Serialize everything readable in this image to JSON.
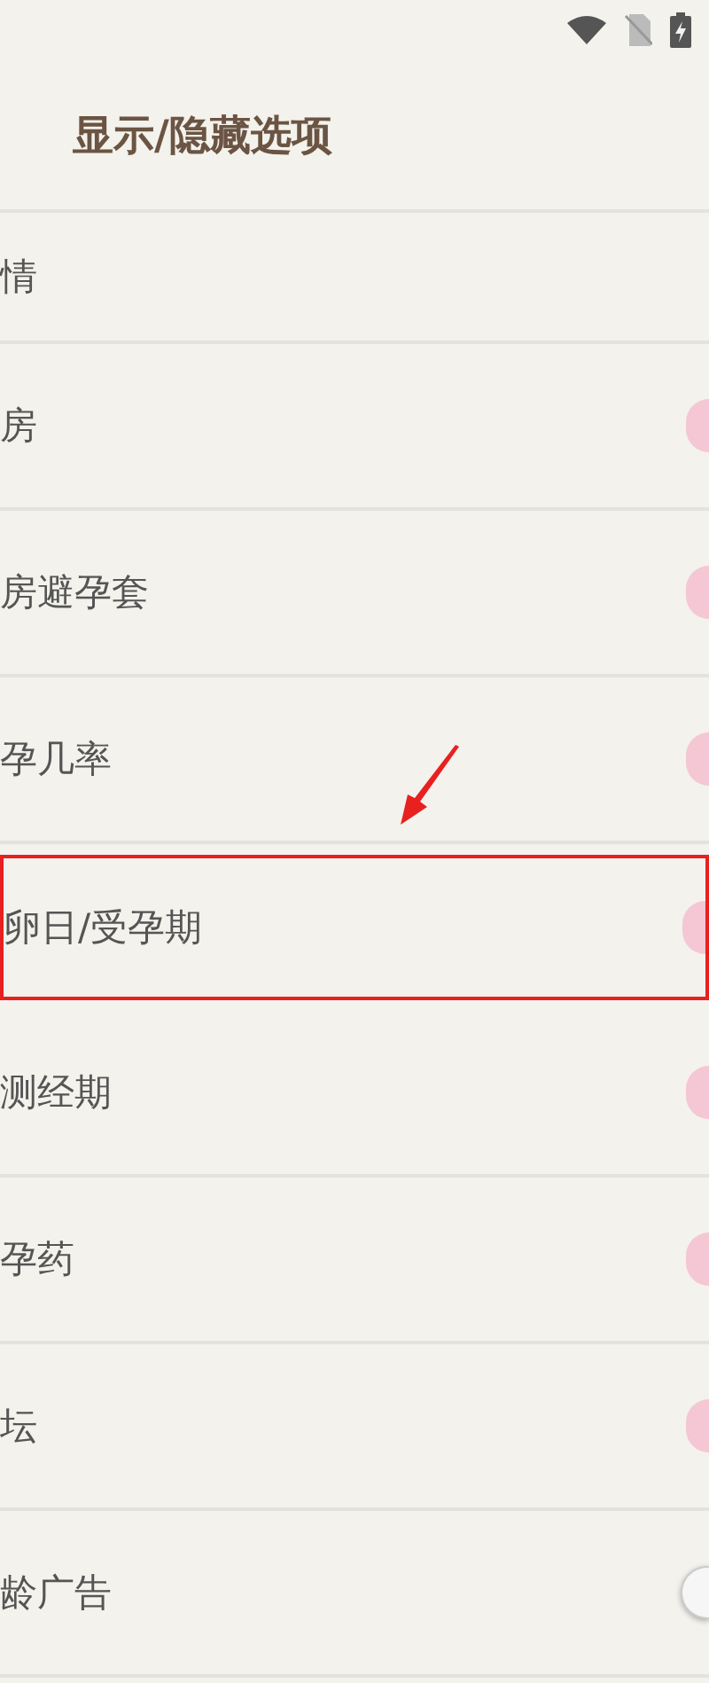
{
  "title": "显示/隐藏选项",
  "options": [
    {
      "label": "情",
      "kind": "plain",
      "highlighted": false
    },
    {
      "label": "房",
      "kind": "switch",
      "on": true,
      "highlighted": false
    },
    {
      "label": "房避孕套",
      "kind": "switch",
      "on": true,
      "highlighted": false
    },
    {
      "label": "孕几率",
      "kind": "switch",
      "on": true,
      "highlighted": false
    },
    {
      "label": "卵日/受孕期",
      "kind": "switch",
      "on": true,
      "highlighted": true
    },
    {
      "label": "测经期",
      "kind": "switch",
      "on": true,
      "highlighted": false
    },
    {
      "label": "孕药",
      "kind": "switch",
      "on": true,
      "highlighted": false
    },
    {
      "label": "坛",
      "kind": "switch",
      "on": true,
      "highlighted": false
    },
    {
      "label": "龄广告",
      "kind": "switch",
      "on": false,
      "highlighted": false
    }
  ]
}
